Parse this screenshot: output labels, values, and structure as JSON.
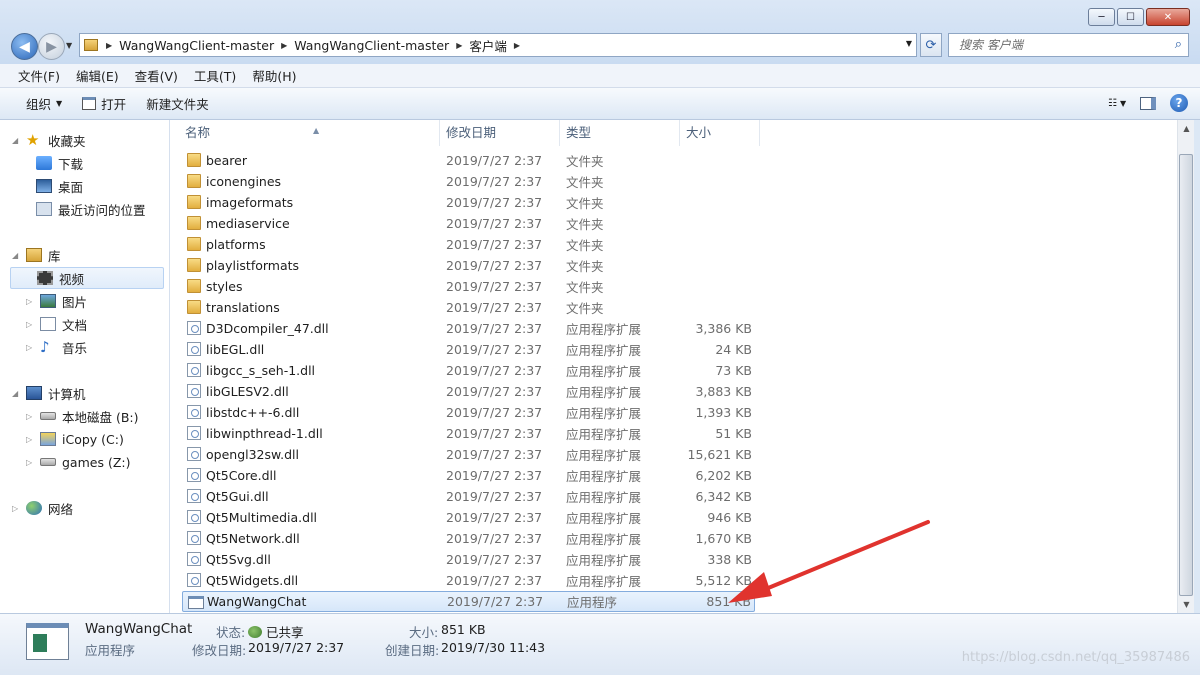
{
  "window": {
    "minimize": "─",
    "maximize": "☐",
    "close": "✕"
  },
  "address": {
    "crumbs": [
      "WangWangClient-master",
      "WangWangClient-master",
      "客户端"
    ]
  },
  "search": {
    "placeholder": "搜索 客户端"
  },
  "menu": [
    "文件(F)",
    "编辑(E)",
    "查看(V)",
    "工具(T)",
    "帮助(H)"
  ],
  "toolbar": {
    "organize": "组织",
    "open": "打开",
    "new_folder": "新建文件夹"
  },
  "nav": {
    "favorites": "收藏夹",
    "downloads": "下载",
    "desktop": "桌面",
    "recent": "最近访问的位置",
    "libraries": "库",
    "videos": "视频",
    "pictures": "图片",
    "documents": "文档",
    "music": "音乐",
    "computer": "计算机",
    "disk_b": "本地磁盘 (B:)",
    "disk_c": "iCopy (C:)",
    "disk_z": "games (Z:)",
    "network": "网络"
  },
  "columns": {
    "name": "名称",
    "date": "修改日期",
    "type": "类型",
    "size": "大小"
  },
  "files": [
    {
      "name": "bearer",
      "date": "2019/7/27 2:37",
      "type": "文件夹",
      "size": "",
      "icon": "folder-icon"
    },
    {
      "name": "iconengines",
      "date": "2019/7/27 2:37",
      "type": "文件夹",
      "size": "",
      "icon": "folder-icon"
    },
    {
      "name": "imageformats",
      "date": "2019/7/27 2:37",
      "type": "文件夹",
      "size": "",
      "icon": "folder-icon"
    },
    {
      "name": "mediaservice",
      "date": "2019/7/27 2:37",
      "type": "文件夹",
      "size": "",
      "icon": "folder-icon"
    },
    {
      "name": "platforms",
      "date": "2019/7/27 2:37",
      "type": "文件夹",
      "size": "",
      "icon": "folder-icon"
    },
    {
      "name": "playlistformats",
      "date": "2019/7/27 2:37",
      "type": "文件夹",
      "size": "",
      "icon": "folder-icon"
    },
    {
      "name": "styles",
      "date": "2019/7/27 2:37",
      "type": "文件夹",
      "size": "",
      "icon": "folder-icon"
    },
    {
      "name": "translations",
      "date": "2019/7/27 2:37",
      "type": "文件夹",
      "size": "",
      "icon": "folder-icon"
    },
    {
      "name": "D3Dcompiler_47.dll",
      "date": "2019/7/27 2:37",
      "type": "应用程序扩展",
      "size": "3,386 KB",
      "icon": "dll-icon"
    },
    {
      "name": "libEGL.dll",
      "date": "2019/7/27 2:37",
      "type": "应用程序扩展",
      "size": "24 KB",
      "icon": "dll-icon"
    },
    {
      "name": "libgcc_s_seh-1.dll",
      "date": "2019/7/27 2:37",
      "type": "应用程序扩展",
      "size": "73 KB",
      "icon": "dll-icon"
    },
    {
      "name": "libGLESV2.dll",
      "date": "2019/7/27 2:37",
      "type": "应用程序扩展",
      "size": "3,883 KB",
      "icon": "dll-icon"
    },
    {
      "name": "libstdc++-6.dll",
      "date": "2019/7/27 2:37",
      "type": "应用程序扩展",
      "size": "1,393 KB",
      "icon": "dll-icon"
    },
    {
      "name": "libwinpthread-1.dll",
      "date": "2019/7/27 2:37",
      "type": "应用程序扩展",
      "size": "51 KB",
      "icon": "dll-icon"
    },
    {
      "name": "opengl32sw.dll",
      "date": "2019/7/27 2:37",
      "type": "应用程序扩展",
      "size": "15,621 KB",
      "icon": "dll-icon"
    },
    {
      "name": "Qt5Core.dll",
      "date": "2019/7/27 2:37",
      "type": "应用程序扩展",
      "size": "6,202 KB",
      "icon": "dll-icon"
    },
    {
      "name": "Qt5Gui.dll",
      "date": "2019/7/27 2:37",
      "type": "应用程序扩展",
      "size": "6,342 KB",
      "icon": "dll-icon"
    },
    {
      "name": "Qt5Multimedia.dll",
      "date": "2019/7/27 2:37",
      "type": "应用程序扩展",
      "size": "946 KB",
      "icon": "dll-icon"
    },
    {
      "name": "Qt5Network.dll",
      "date": "2019/7/27 2:37",
      "type": "应用程序扩展",
      "size": "1,670 KB",
      "icon": "dll-icon"
    },
    {
      "name": "Qt5Svg.dll",
      "date": "2019/7/27 2:37",
      "type": "应用程序扩展",
      "size": "338 KB",
      "icon": "dll-icon"
    },
    {
      "name": "Qt5Widgets.dll",
      "date": "2019/7/27 2:37",
      "type": "应用程序扩展",
      "size": "5,512 KB",
      "icon": "dll-icon"
    },
    {
      "name": "WangWangChat",
      "date": "2019/7/27 2:37",
      "type": "应用程序",
      "size": "851 KB",
      "icon": "exe-icon",
      "selected": true
    }
  ],
  "details": {
    "name": "WangWangChat",
    "kind": "应用程序",
    "status_label": "状态:",
    "status_value": "已共享",
    "modified_label": "修改日期:",
    "modified_value": "2019/7/27 2:37",
    "size_label": "大小:",
    "size_value": "851 KB",
    "created_label": "创建日期:",
    "created_value": "2019/7/30 11:43"
  },
  "watermark": "https://blog.csdn.net/qq_35987486",
  "colors": {
    "accent": "#2c5fa8",
    "selection": "#d6e7fa",
    "annotation_arrow": "#e0332e"
  }
}
